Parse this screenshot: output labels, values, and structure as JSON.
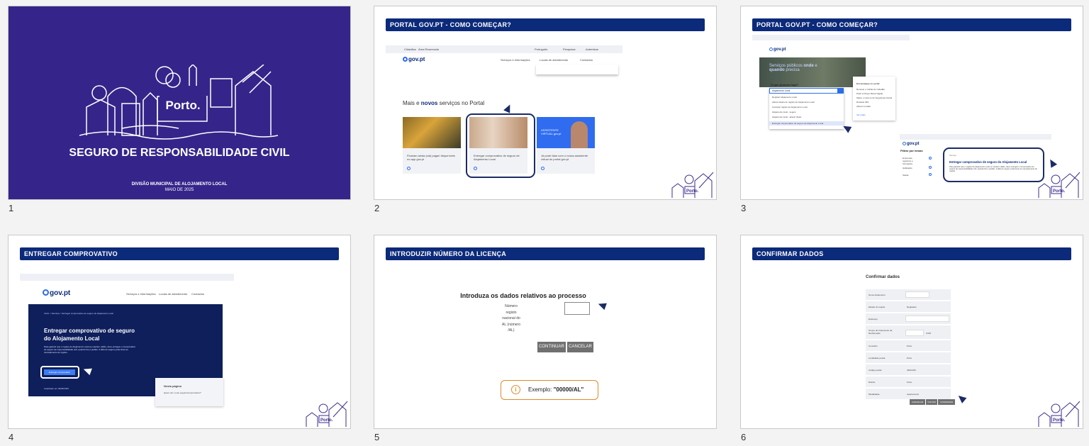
{
  "slides": [
    {
      "number": "1",
      "title": "SEGURO DE RESPONSABILIDADE CIVIL",
      "brand": "Porto.",
      "footer_line1": "DIVISÃO MUNICIPAL DE ALOJAMENTO LOCAL",
      "footer_line2": "MAIO DE 2025"
    },
    {
      "number": "2",
      "header": "PORTAL GOV.PT - COMO COMEÇAR?",
      "topbar": {
        "tab1": "Cidadãos",
        "tab2": "Área Reservada",
        "lang": "Português",
        "search": "Pesquisar",
        "login": "Autenticar"
      },
      "logo": "gov.pt",
      "nav": {
        "item1": "Serviços e informações",
        "item2": "Locais de atendimento",
        "item3": "Contactos"
      },
      "section_title_pre": "Mais e ",
      "section_title_bold": "novos",
      "section_title_post": " serviços no Portal",
      "cards": [
        {
          "text": "Ficaram ainda (vai) pagar/ disponíveis no app gov.pt"
        },
        {
          "text": "Entregar comprovativo de seguro de Alojamento Local"
        },
        {
          "text": "Já pode falar com o nosso assistente virtual do portal gov.pt"
        }
      ],
      "promo_text": "ASSISTENTE VIRTUAL gov.pt"
    },
    {
      "number": "3",
      "header": "PORTAL GOV.PT - COMO COMEÇAR?",
      "hero_line1": "Serviços públicos ",
      "hero_bold1": "onde",
      "hero_line2": " e",
      "hero_bold2": "quando",
      "hero_line3": " precisa",
      "search_label": "O que procura hoje?",
      "search_value": "alojamento local",
      "suggestions": [
        "Registar Alojamento Local",
        "Alterar dados do registo de Alojamento Local",
        "Cancelar registo de Alojamento Local",
        "Alojamento local - seguro",
        "Alojamento local - alterar titular",
        "Entregar comprovativo de seguro de Alojamento Local"
      ],
      "side_title": "Em destaque no portal",
      "side_items": [
        "Renovar o Cartão de Cidadão",
        "Pedir a Chave Móvel Digital",
        "Saber o número de Segurança Social",
        "Declarar IRS",
        "Alterar morada"
      ],
      "side_more": "Ver todos",
      "filter_title": "Filtrar por temas",
      "filters": [
        "Empresas, negócios e formações",
        "Habitação",
        "Saúde"
      ],
      "result_tag": "Serviço",
      "result_title": "Entregar comprovativo de seguro do Alojamento Local",
      "result_desc": "Para garantir que o registo do Alojamento Local se mantém válido, deve entregar o comprovativo do seguro de responsabilidade civil, quando lhe é pedido. A falta do seguro pode levar ao cancelamento do registo."
    },
    {
      "number": "4",
      "header": "ENTREGAR COMPROVATIVO",
      "breadcrumb": "Início  >  Serviços  >  Entregar comprovativo de seguro do Alojamento Local",
      "hero_title": "Entregar comprovativo de seguro do Alojamento Local",
      "hero_desc": "Para garantir que o registo do Alojamento Local se mantém válido, deve entregar o comprovativo do seguro de responsabilidade civil, quando lhe é pedido. A falta do seguro pode levar ao cancelamento do registo.",
      "button_label": "Entregar comprovativo",
      "updated": "Atualizado em 03/09/2025",
      "panel_title": "Nesta página",
      "panel_item": "Quem tem a seu seguro/comprovativo?"
    },
    {
      "number": "5",
      "header": "INTRODUZIR NÚMERO DA LICENÇA",
      "form_title": "Introduza os dados relativos ao processo",
      "field_label": "Número registo nacional do AL (número /AL)",
      "continue_label": "CONTINUAR",
      "cancel_label": "CANCELAR",
      "example_label": "Exemplo: ",
      "example_value": "\"00000/AL\""
    },
    {
      "number": "6",
      "header": "CONFIRMAR DADOS",
      "confirm_title": "Confirmar dados",
      "rows": [
        {
          "label": "Nome Alojamento",
          "value": ""
        },
        {
          "label": "Estado do registo",
          "value": "Registado"
        },
        {
          "label": "Endereço",
          "value": ""
        },
        {
          "label": "Tempo de Tratamento da Reclamação",
          "value": "COM"
        },
        {
          "label": "Concelho",
          "value": "Porto"
        },
        {
          "label": "Localidade postal",
          "value": "Porto"
        },
        {
          "label": "Código postal",
          "value": "4000-000"
        },
        {
          "label": "Distrito",
          "value": "Porto"
        },
        {
          "label": "Modalidade",
          "value": "Apartamento"
        }
      ],
      "buttons": [
        "CANCELAR",
        "VOLTAR",
        "CONFIRMAR"
      ]
    }
  ],
  "corner_brand": "Porto.",
  "colors": {
    "cover_bg": "#35258a",
    "header_bar": "#0c2a7a",
    "accent": "#2b6de8",
    "highlight": "#1b2b64",
    "example_border": "#e08a2a"
  }
}
